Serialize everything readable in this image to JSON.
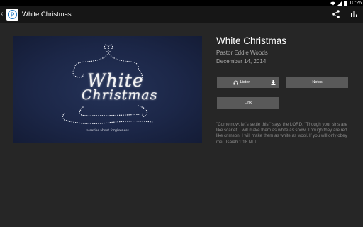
{
  "status_bar": {
    "time": "10:26"
  },
  "app_bar": {
    "title": "White Christmas",
    "icons": [
      "back-arrow-icon",
      "app-logo-icon",
      "share-icon",
      "bar-chart-icon"
    ]
  },
  "artwork": {
    "line1": "White",
    "line2": "Christmas",
    "tagline": "a series about forgiveness"
  },
  "sermon": {
    "title": "White Christmas",
    "speaker": "Pastor Eddie Woods",
    "date": "December 14, 2014"
  },
  "buttons": {
    "listen": "Listen",
    "notes": "Notes",
    "link": "Link"
  },
  "scripture": "\"Come now, let's settle this,\" says the LORD. \"Though your sins are like scarlet, I will make them as white as snow. Though they are red like crimson, I will make them as white as wool. If you will only obey me...Isaiah 1:18 NLT",
  "colors": {
    "background": "#262626",
    "app_bar": "#161616",
    "button": "#595959",
    "artwork_navy": "#1c2748"
  }
}
